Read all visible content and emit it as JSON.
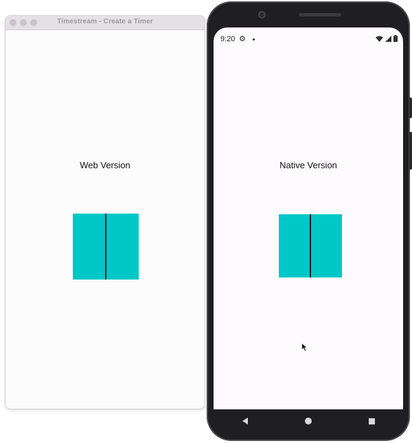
{
  "web_window": {
    "title": "Timestream - Create a Timer",
    "label": "Web Version",
    "box_color": "#00c8c8"
  },
  "phone": {
    "status_time": "9:20",
    "status_icons": [
      "gear-icon",
      "dot-icon",
      "wifi-icon",
      "signal-icon",
      "battery-icon"
    ],
    "label": "Native Version",
    "box_color": "#00c8c8",
    "nav_buttons": [
      "back-icon",
      "home-icon",
      "recents-icon"
    ]
  }
}
